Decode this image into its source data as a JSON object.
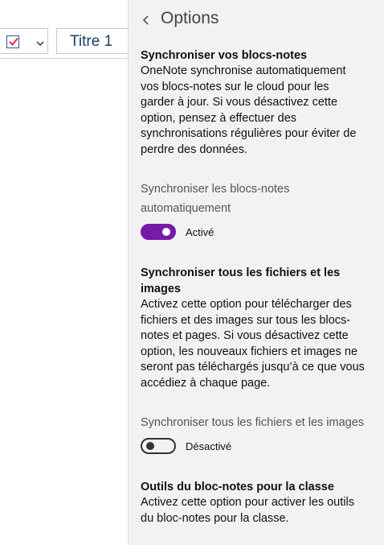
{
  "ribbon": {
    "style_label": "Titre 1"
  },
  "pane": {
    "title": "Options"
  },
  "sections": [
    {
      "title": "Synchroniser vos blocs-notes",
      "description": "OneNote synchronise automatiquement vos blocs-notes sur le cloud pour les garder à jour. Si vous désactivez cette option, pensez à effectuer des synchronisations régulières pour éviter de perdre des données.",
      "option_label": "Synchroniser les blocs-notes automatiquement",
      "toggle_on": true,
      "toggle_state": "Activé"
    },
    {
      "title": "Synchroniser tous les fichiers et les images",
      "description": "Activez cette option pour télécharger des fichiers et des images sur tous les blocs-notes et pages. Si vous désactivez cette option, les nouveaux fichiers et images ne seront pas téléchargés jusqu’à ce que vous accédiez à chaque page.",
      "option_label": "Synchroniser tous les fichiers et les images",
      "toggle_on": false,
      "toggle_state": "Désactivé"
    },
    {
      "title": "Outils du bloc-notes pour la classe",
      "description": "Activez cette option pour activer les outils du bloc-notes pour la classe."
    }
  ],
  "colors": {
    "accent": "#7719aa",
    "pane_background": "#f2f2f2",
    "style_text": "#1f3b66",
    "checkbox_mark": "#d13438"
  },
  "icons": {
    "back": "chevron-left-icon",
    "todo": "checkbox-checked-icon",
    "dropdown": "chevron-down-icon"
  }
}
